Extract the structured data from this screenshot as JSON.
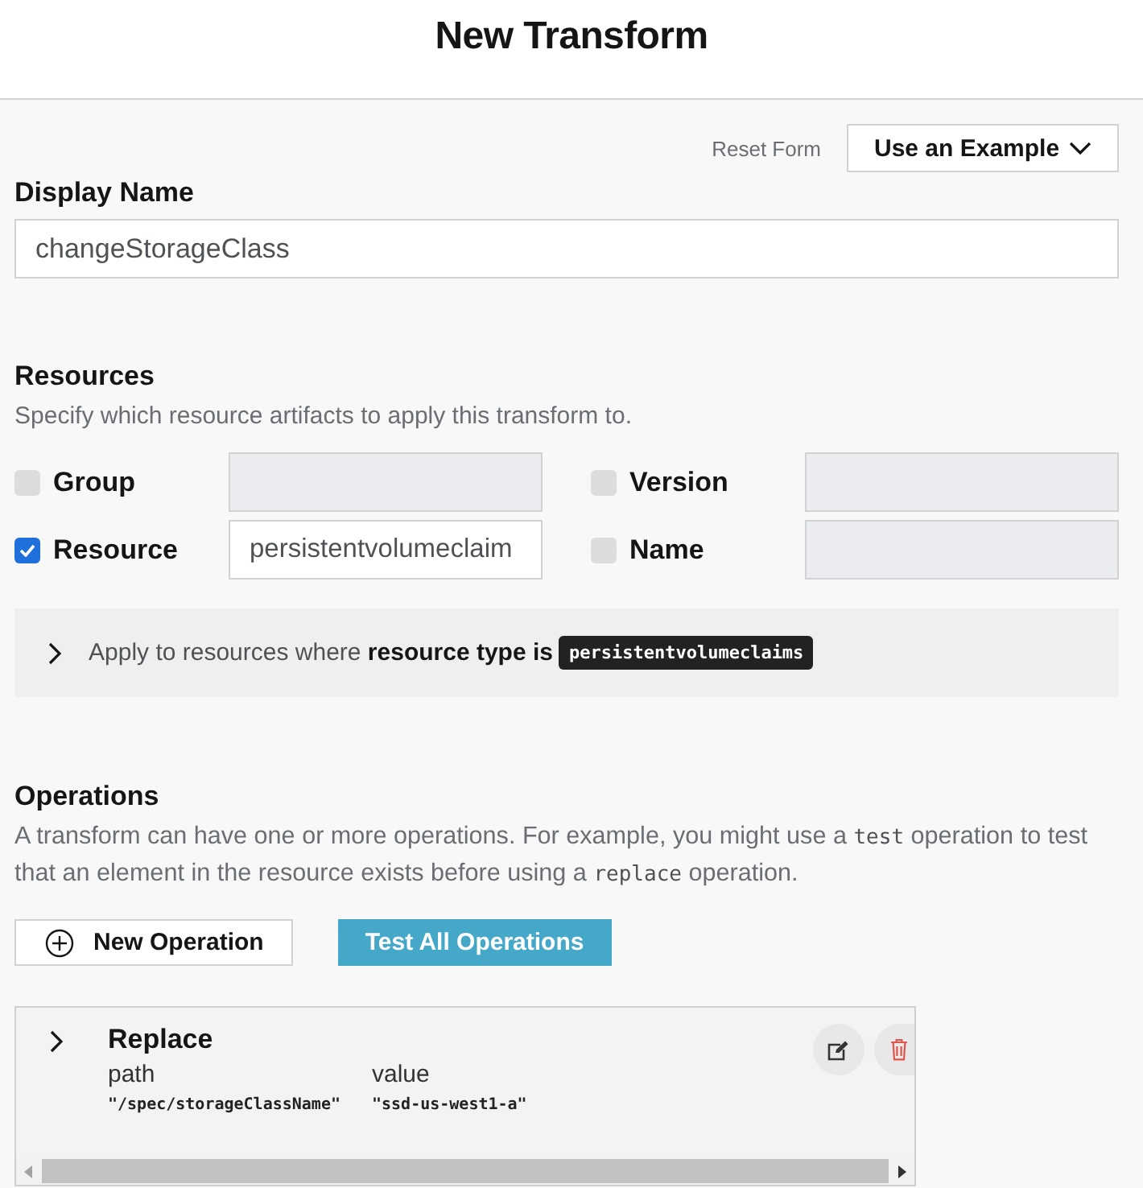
{
  "header": {
    "title": "New Transform"
  },
  "toolbar": {
    "reset_link": "Reset Form",
    "example_dropdown": "Use an Example"
  },
  "display_name": {
    "label": "Display Name",
    "value": "changeStorageClass"
  },
  "resources": {
    "heading": "Resources",
    "description": "Specify which resource artifacts to apply this transform to.",
    "fields": [
      {
        "label": "Group",
        "checked": false
      },
      {
        "label": "Version",
        "checked": false
      },
      {
        "label": "Resource",
        "checked": true,
        "value": "persistentvolumeclaim"
      },
      {
        "label": "Name",
        "checked": false
      }
    ],
    "filter": {
      "expanded": false,
      "text": "Apply to resources where **resource type is**",
      "code": "persistentvolumeclaims"
    }
  },
  "operations": {
    "heading": "Operations",
    "description": [
      {
        "kind": "text",
        "text": "A transform can have one or more operations. For example, you might use a "
      },
      {
        "kind": "code",
        "text": "test"
      },
      {
        "kind": "text",
        "text": " operation to test that an element in the resource exists before using a "
      },
      {
        "kind": "code",
        "text": "replace"
      },
      {
        "kind": "text",
        "text": " operation."
      }
    ],
    "buttons": [
      {
        "kind": "outline",
        "label": "New Operation"
      },
      {
        "kind": "primary",
        "label": "Test All Operations"
      }
    ],
    "items": [
      {
        "name": "Replace",
        "expanded": false,
        "columns": [
          {
            "label": "path",
            "value": "\"/spec/storageClassName\""
          },
          {
            "label": "value",
            "value": "\"ssd-us-west1-a\""
          }
        ]
      }
    ]
  }
}
